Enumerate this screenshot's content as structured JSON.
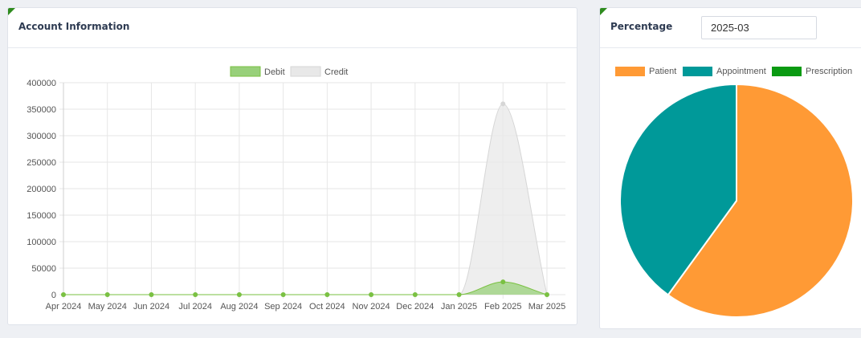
{
  "account": {
    "title": "Account Information"
  },
  "percentage": {
    "title": "Percentage",
    "month_value": "2025-03"
  },
  "chart_data": [
    {
      "type": "area",
      "categories": [
        "Apr 2024",
        "May 2024",
        "Jun 2024",
        "Jul 2024",
        "Aug 2024",
        "Sep 2024",
        "Oct 2024",
        "Nov 2024",
        "Dec 2024",
        "Jan 2025",
        "Feb 2025",
        "Mar 2025"
      ],
      "series": [
        {
          "name": "Debit",
          "color": "#7ac142",
          "fill": "#98d07a",
          "values": [
            0,
            0,
            0,
            0,
            0,
            0,
            0,
            0,
            0,
            0,
            24000,
            0
          ]
        },
        {
          "name": "Credit",
          "color": "#d6d6d6",
          "fill": "#e8e8e8",
          "values": [
            0,
            0,
            0,
            0,
            0,
            0,
            0,
            0,
            0,
            0,
            360000,
            0
          ]
        }
      ],
      "ylim": [
        0,
        400000
      ],
      "yticks": [
        "0",
        "50000",
        "100000",
        "150000",
        "200000",
        "250000",
        "300000",
        "350000",
        "400000"
      ],
      "grid": true,
      "legend": "top"
    },
    {
      "type": "pie",
      "labels": [
        "Patient",
        "Appointment",
        "Prescription"
      ],
      "values": [
        60,
        40,
        0
      ],
      "colors": [
        "#ff9a35",
        "#009999",
        "#0a9a12"
      ],
      "legend": "top"
    }
  ]
}
